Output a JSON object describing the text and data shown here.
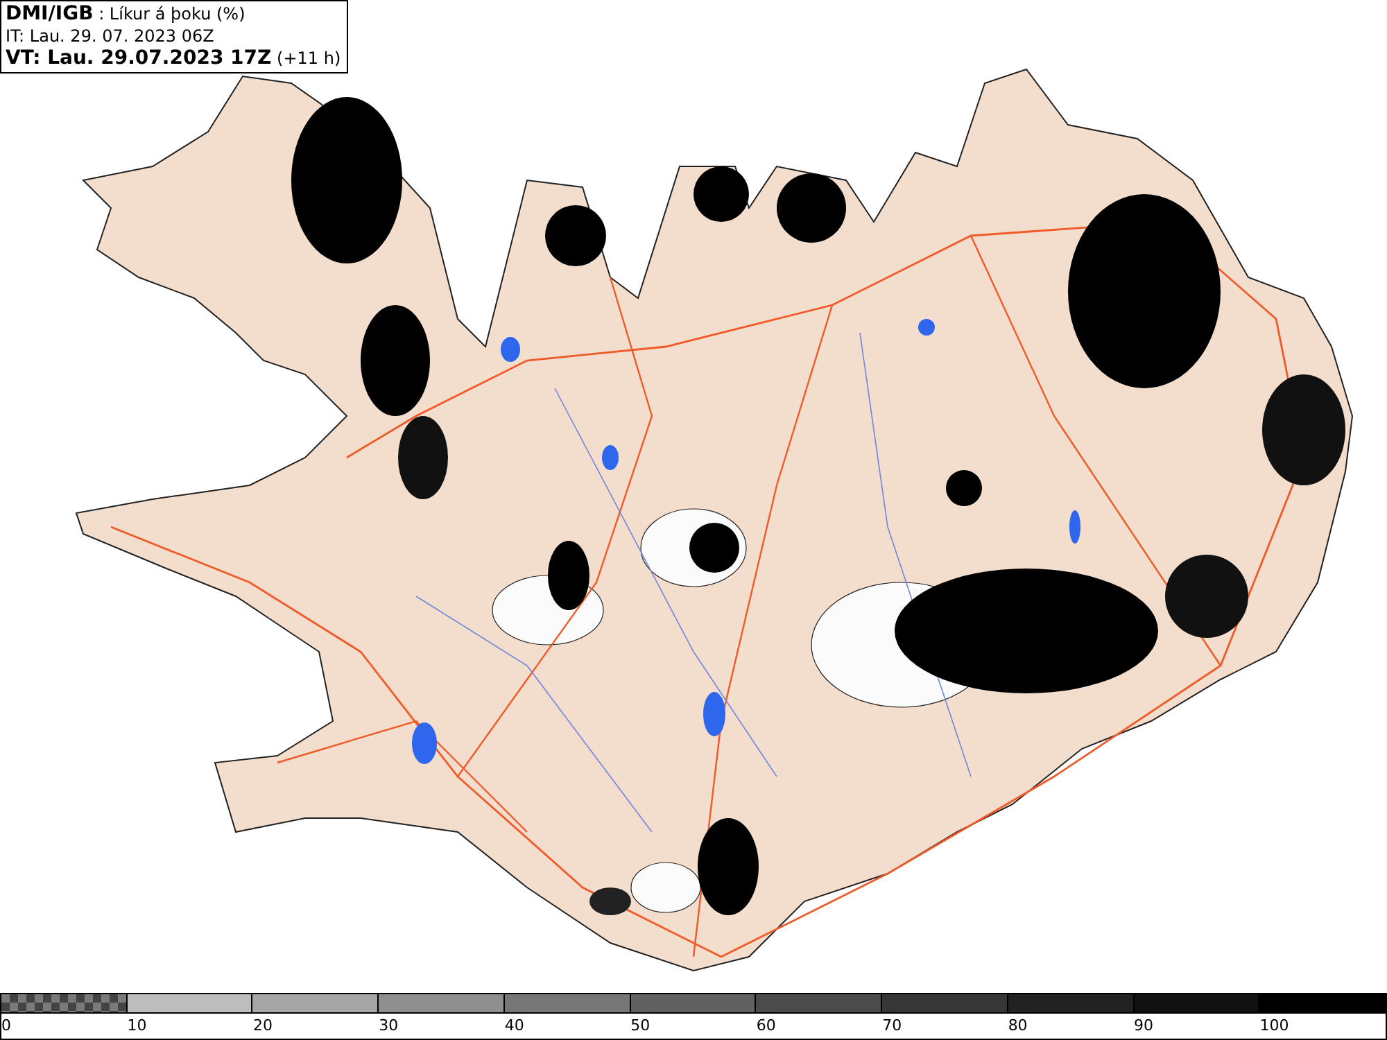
{
  "header": {
    "lines": [
      "**DMI/IGB** : Líkur á þoku (%)",
      "IT: Lau. 29. 07. 2023 06Z",
      "**VT: Lau. 29.07.2023 17Z** (+11 h)"
    ]
  },
  "legend": {
    "segments": [
      {
        "kind": "checkered",
        "color": "#7a7a7a"
      },
      {
        "kind": "solid",
        "color": "#bdbdbd"
      },
      {
        "kind": "solid",
        "color": "#a6a6a6"
      },
      {
        "kind": "solid",
        "color": "#8f8f8f"
      },
      {
        "kind": "solid",
        "color": "#777777"
      },
      {
        "kind": "solid",
        "color": "#616161"
      },
      {
        "kind": "solid",
        "color": "#4b4b4b"
      },
      {
        "kind": "solid",
        "color": "#363636"
      },
      {
        "kind": "solid",
        "color": "#222222"
      },
      {
        "kind": "solid",
        "color": "#111111"
      },
      {
        "kind": "solid",
        "color": "#000000"
      }
    ],
    "ticks": [
      "0",
      "10",
      "20",
      "30",
      "40",
      "50",
      "60",
      "70",
      "80",
      "90",
      "100"
    ]
  }
}
